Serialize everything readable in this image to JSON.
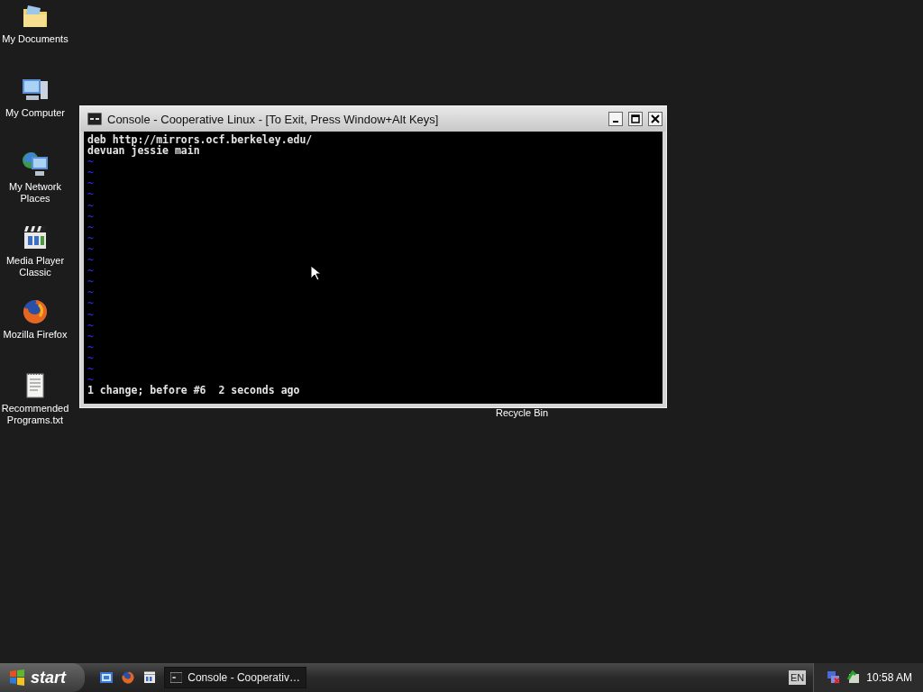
{
  "desktop_icons": [
    {
      "label": "My Documents",
      "kind": "folder"
    },
    {
      "label": "My Computer",
      "kind": "computer"
    },
    {
      "label": "My Network Places",
      "kind": "network"
    },
    {
      "label": "Media Player Classic",
      "kind": "media"
    },
    {
      "label": "Mozilla Firefox",
      "kind": "firefox"
    },
    {
      "label": "Recommended Programs.txt",
      "kind": "text"
    }
  ],
  "recycle_bin": {
    "label": "Recycle Bin"
  },
  "window": {
    "title": "Console - Cooperative Linux - [To Exit, Press Window+Alt Keys]",
    "lines": [
      "deb http://mirrors.ocf.berkeley.edu/",
      "devuan jessie main"
    ],
    "empty_lines": [
      "~",
      "~",
      "~",
      "~",
      "~",
      "~",
      "~",
      "~",
      "~",
      "~",
      "~",
      "~",
      "~",
      "~",
      "~",
      "~",
      "~",
      "~",
      "~",
      "~",
      "~"
    ],
    "status_line": "1 change; before #6  2 seconds ago"
  },
  "taskbar": {
    "start": "start",
    "quick_launch": [
      {
        "kind": "desktop"
      },
      {
        "kind": "firefox"
      },
      {
        "kind": "media"
      }
    ],
    "tasks": [
      {
        "label": "Console - Cooperativ…",
        "selected": false
      }
    ],
    "language": "EN",
    "clock": "10:58 AM"
  }
}
